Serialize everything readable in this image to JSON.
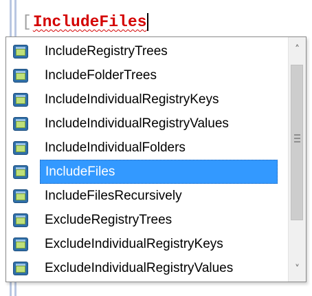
{
  "editor": {
    "open_bracket": "[",
    "typed_text": "IncludeFiles"
  },
  "completion_list": {
    "items": [
      {
        "label": "IncludeRegistryTrees",
        "icon": "tag-icon",
        "selected": false
      },
      {
        "label": "IncludeFolderTrees",
        "icon": "tag-icon",
        "selected": false
      },
      {
        "label": "IncludeIndividualRegistryKeys",
        "icon": "tag-icon",
        "selected": false
      },
      {
        "label": "IncludeIndividualRegistryValues",
        "icon": "tag-icon",
        "selected": false
      },
      {
        "label": "IncludeIndividualFolders",
        "icon": "tag-icon",
        "selected": false
      },
      {
        "label": "IncludeFiles",
        "icon": "tag-icon",
        "selected": true
      },
      {
        "label": "IncludeFilesRecursively",
        "icon": "tag-icon",
        "selected": false
      },
      {
        "label": "ExcludeRegistryTrees",
        "icon": "tag-icon",
        "selected": false
      },
      {
        "label": "ExcludeIndividualRegistryKeys",
        "icon": "tag-icon",
        "selected": false
      },
      {
        "label": "ExcludeIndividualRegistryValues",
        "icon": "tag-icon",
        "selected": false
      }
    ],
    "selected_index": 5
  },
  "scrollbar": {
    "up_arrow": "˄",
    "down_arrow": "˅"
  },
  "colors": {
    "selection_bg": "#3399ff",
    "error_text": "#d40000",
    "gutter": "#b9c7e2"
  }
}
